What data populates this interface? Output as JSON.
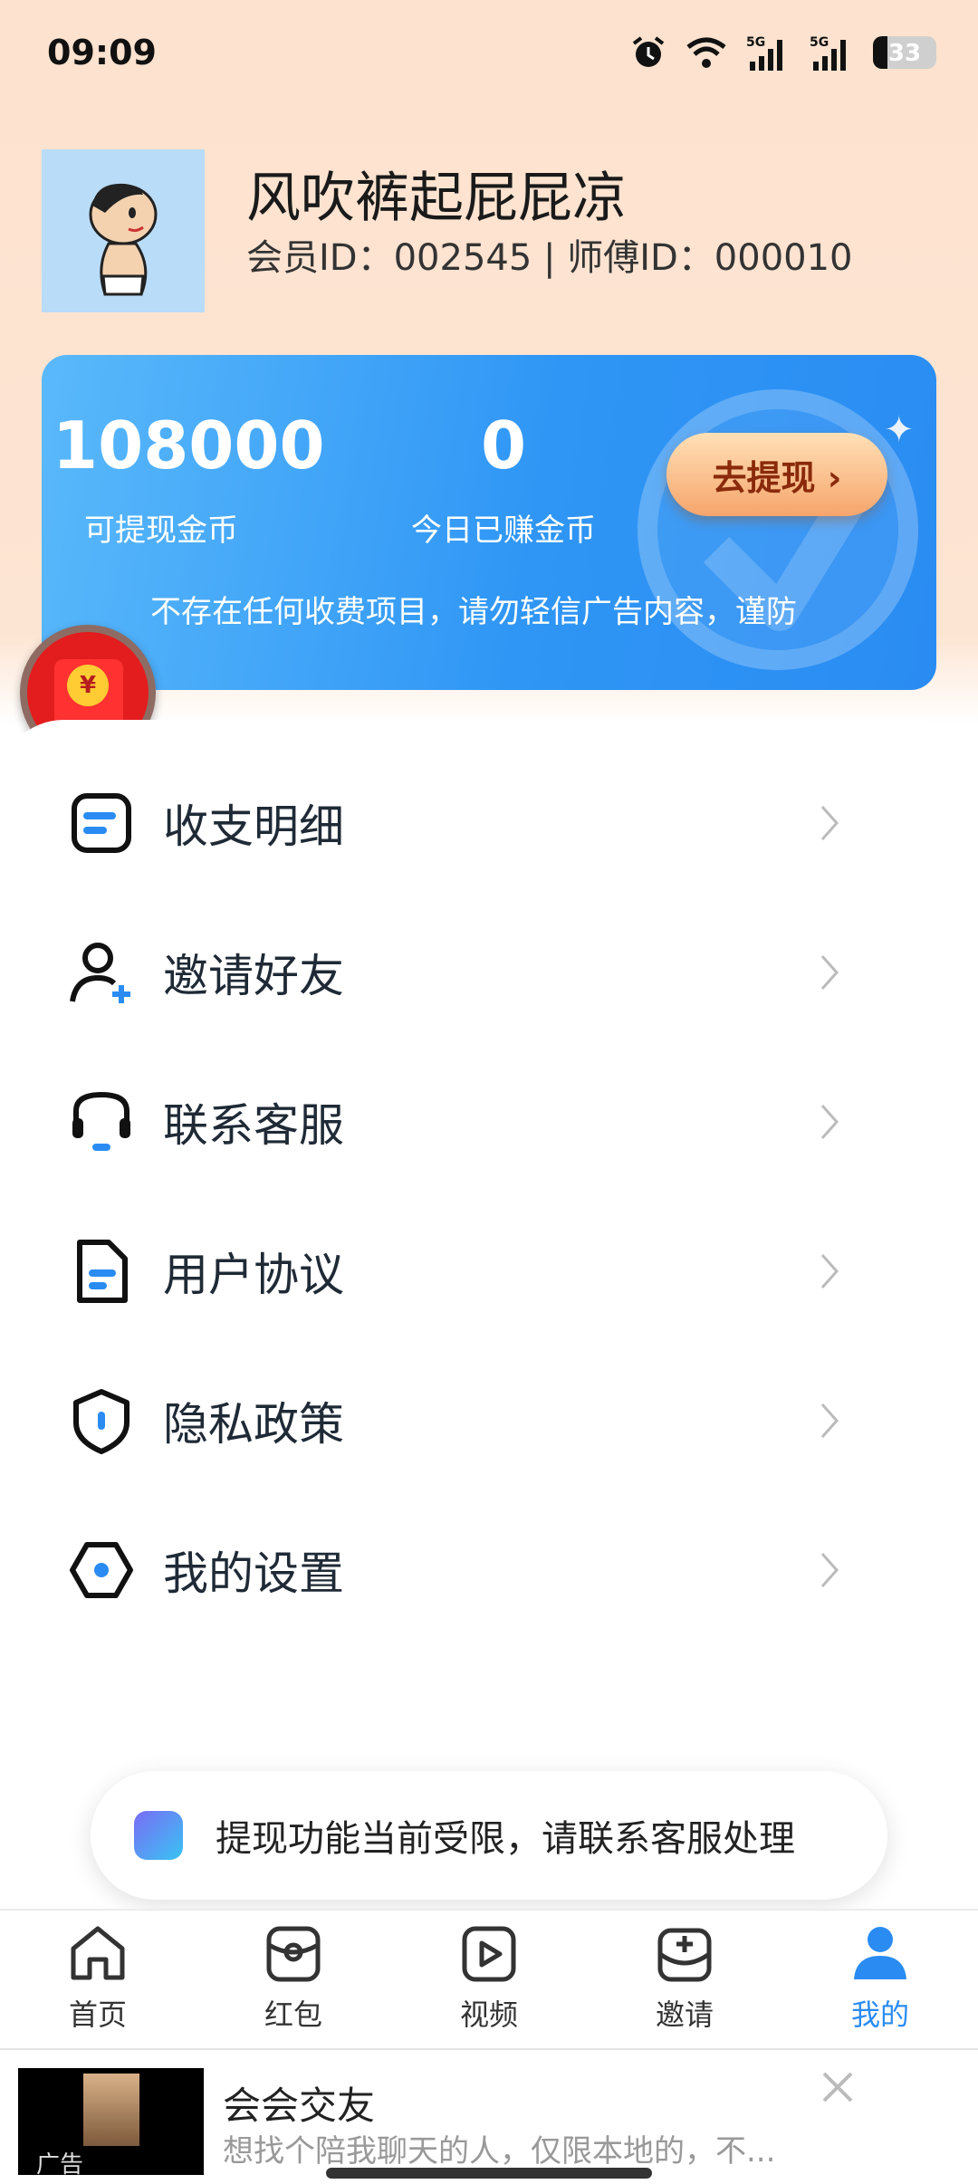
{
  "status_bar": {
    "time": "09:09",
    "battery": "33",
    "network_1": "5G",
    "network_2": "5G"
  },
  "profile": {
    "username": "风吹裤起屁屁凉",
    "ids": "会员ID：002545 | 师傅ID：000010"
  },
  "wallet": {
    "withdrawable_value": "108000",
    "withdrawable_label": "可提现金币",
    "today_value": "0",
    "today_label": "今日已赚金币",
    "withdraw_button": "去提现 ›",
    "notice": "不存在任何收费项目，请勿轻信广告内容，谨防"
  },
  "red_envelope": {
    "symbol": "¥"
  },
  "menu": {
    "items": [
      {
        "label": "收支明细",
        "icon": "receipt-icon"
      },
      {
        "label": "邀请好友",
        "icon": "add-user-icon"
      },
      {
        "label": "联系客服",
        "icon": "headset-icon"
      },
      {
        "label": "用户协议",
        "icon": "document-icon"
      },
      {
        "label": "隐私政策",
        "icon": "shield-icon"
      },
      {
        "label": "我的设置",
        "icon": "settings-icon"
      }
    ]
  },
  "toast": {
    "text": "提现功能当前受限，请联系客服处理"
  },
  "tabs": [
    {
      "label": "首页",
      "icon": "home-icon"
    },
    {
      "label": "红包",
      "icon": "red-packet-icon"
    },
    {
      "label": "视频",
      "icon": "video-icon"
    },
    {
      "label": "邀请",
      "icon": "invite-icon"
    },
    {
      "label": "我的",
      "icon": "profile-icon",
      "active": true
    }
  ],
  "ad": {
    "tag": "广告",
    "title": "会会交友",
    "description": "想找个陪我聊天的人，仅限本地的，不..."
  },
  "colors": {
    "accent": "#2a8cf2",
    "card_start": "#5ab9fb",
    "card_end": "#2a8cf2",
    "button_text": "#8a2a0b"
  }
}
